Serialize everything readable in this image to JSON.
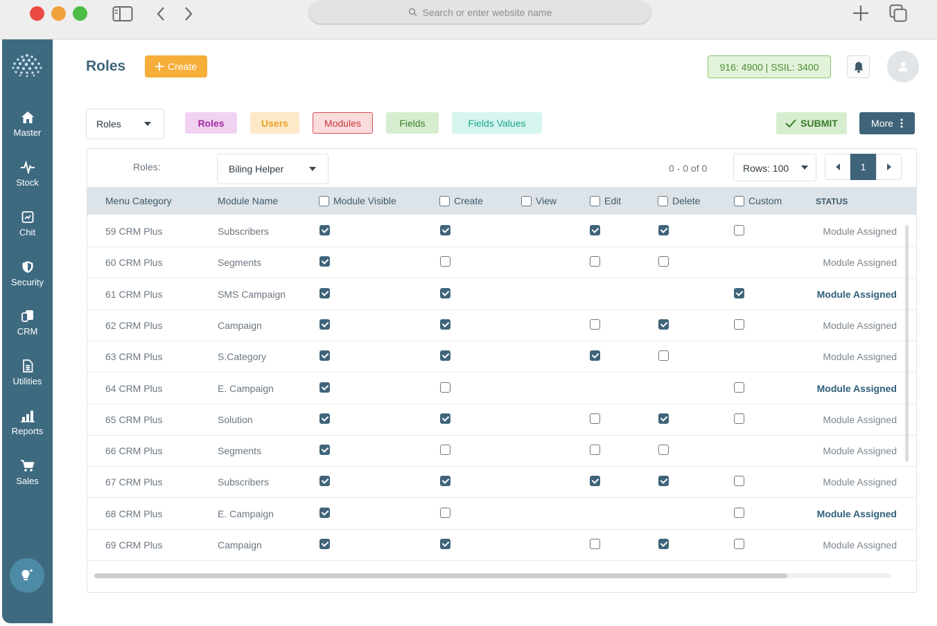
{
  "browser": {
    "search_placeholder": "Search or enter website name"
  },
  "sidebar": {
    "items": [
      {
        "label": "Master",
        "icon": "home-icon"
      },
      {
        "label": "Stock",
        "icon": "pulse-icon"
      },
      {
        "label": "Chit",
        "icon": "chit-icon"
      },
      {
        "label": "Security",
        "icon": "shield-icon"
      },
      {
        "label": "CRM",
        "icon": "crm-icon"
      },
      {
        "label": "Utilities",
        "icon": "document-icon"
      },
      {
        "label": "Reports",
        "icon": "bar-chart-icon"
      },
      {
        "label": "Sales",
        "icon": "cart-icon"
      }
    ]
  },
  "header": {
    "title": "Roles",
    "create_label": "Create",
    "balance": "916: 4900 | SSIL: 3400"
  },
  "toolbar": {
    "roles_select": "Roles",
    "chips": [
      {
        "label": "Roles",
        "bg": "#f1d2f1",
        "fg": "#a227a2",
        "border": "#f1d2f1"
      },
      {
        "label": "Users",
        "bg": "#fde9c7",
        "fg": "#eaa22a",
        "border": "#fde9c7"
      },
      {
        "label": "Modules",
        "bg": "#fbdcdd",
        "fg": "#c7363f",
        "border": "#d84b54"
      },
      {
        "label": "Fields",
        "bg": "#d7edcf",
        "fg": "#3f7f2c",
        "border": "#d7edcf"
      },
      {
        "label": "Fields Values",
        "bg": "#d5f5ee",
        "fg": "#1aa58c",
        "border": "#d5f5ee"
      }
    ],
    "submit_label": "SUBMIT",
    "more_label": "More"
  },
  "filter": {
    "roles_label": "Roles:",
    "role_value": "Biling Helper",
    "range": "0 - 0 of 0",
    "rows_label": "Rows: 100",
    "page": "1"
  },
  "table": {
    "headers": {
      "menu_category": "Menu Category",
      "module_name": "Module Name",
      "module_visible": "Module Visible",
      "create": "Create",
      "view": "View",
      "edit": "Edit",
      "delete": "Delete",
      "custom": "Custom",
      "status": "STATUS"
    },
    "rows": [
      {
        "category": "59 CRM Plus",
        "module": "Subscribers",
        "visible": true,
        "create": true,
        "view": null,
        "edit": true,
        "delete": true,
        "custom": false,
        "status": "Module Assigned",
        "highlight": false
      },
      {
        "category": "60 CRM Plus",
        "module": "Segments",
        "visible": true,
        "create": false,
        "view": null,
        "edit": false,
        "delete": false,
        "custom": null,
        "status": "Module Assigned",
        "highlight": false
      },
      {
        "category": "61 CRM Plus",
        "module": "SMS Campaign",
        "visible": true,
        "create": true,
        "view": null,
        "edit": null,
        "delete": null,
        "custom": true,
        "status": "Module Assigned",
        "highlight": true
      },
      {
        "category": "62 CRM Plus",
        "module": "Campaign",
        "visible": true,
        "create": true,
        "view": null,
        "edit": false,
        "delete": true,
        "custom": false,
        "status": "Module Assigned",
        "highlight": false
      },
      {
        "category": "63 CRM Plus",
        "module": "S.Category",
        "visible": true,
        "create": true,
        "view": null,
        "edit": true,
        "delete": false,
        "custom": null,
        "status": "Module Assigned",
        "highlight": false
      },
      {
        "category": "64 CRM Plus",
        "module": "E. Campaign",
        "visible": true,
        "create": false,
        "view": null,
        "edit": null,
        "delete": null,
        "custom": false,
        "status": "Module Assigned",
        "highlight": true
      },
      {
        "category": "65 CRM Plus",
        "module": "Solution",
        "visible": true,
        "create": true,
        "view": null,
        "edit": false,
        "delete": true,
        "custom": false,
        "status": "Module Assigned",
        "highlight": false
      },
      {
        "category": "66 CRM Plus",
        "module": "Segments",
        "visible": true,
        "create": false,
        "view": null,
        "edit": false,
        "delete": false,
        "custom": null,
        "status": "Module Assigned",
        "highlight": false
      },
      {
        "category": "67 CRM Plus",
        "module": "Subscribers",
        "visible": true,
        "create": true,
        "view": null,
        "edit": true,
        "delete": true,
        "custom": false,
        "status": "Module Assigned",
        "highlight": false
      },
      {
        "category": "68 CRM Plus",
        "module": "E. Campaign",
        "visible": true,
        "create": false,
        "view": null,
        "edit": null,
        "delete": null,
        "custom": false,
        "status": "Module Assigned",
        "highlight": true
      },
      {
        "category": "69 CRM Plus",
        "module": "Campaign",
        "visible": true,
        "create": true,
        "view": null,
        "edit": false,
        "delete": true,
        "custom": false,
        "status": "Module Assigned",
        "highlight": false
      }
    ]
  }
}
